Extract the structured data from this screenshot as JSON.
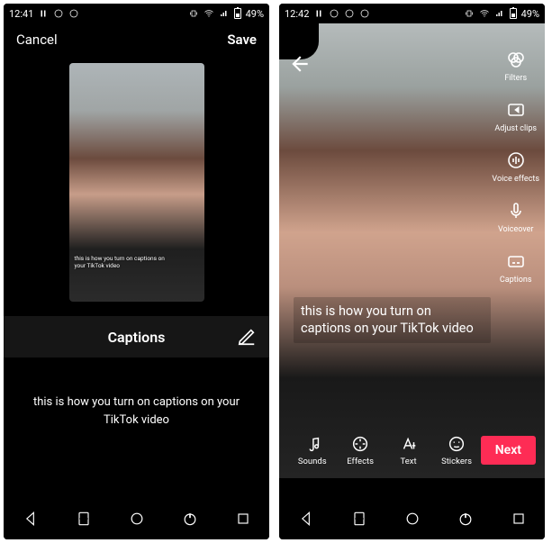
{
  "statusL": {
    "time": "12:41",
    "battery": "49%"
  },
  "statusR": {
    "time": "12:42",
    "battery": "49%"
  },
  "left": {
    "cancel": "Cancel",
    "save": "Save",
    "captions_header": "Captions",
    "preview_caption_line1": "this is how you turn on captions on",
    "preview_caption_line2": "your TikTok video",
    "caption_text": "this is how you turn on captions on your TikTok video"
  },
  "right": {
    "overlay_caption": "this is how you turn on captions on your TikTok video",
    "side": {
      "filters": "Filters",
      "adjust": "Adjust clips",
      "voicefx": "Voice effects",
      "voiceover": "Voiceover",
      "captions": "Captions"
    },
    "bottom": {
      "sounds": "Sounds",
      "effects": "Effects",
      "text": "Text",
      "stickers": "Stickers",
      "next": "Next"
    }
  }
}
